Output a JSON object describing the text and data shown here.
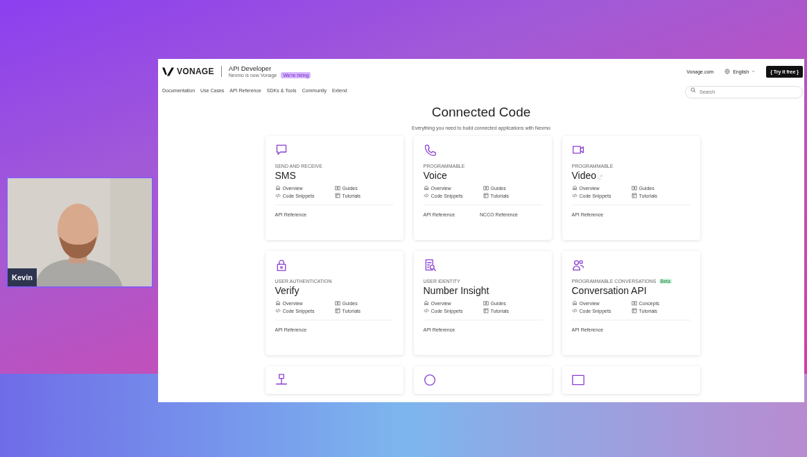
{
  "participant": {
    "kind": "picture",
    "name": "Kevin"
  },
  "browser": {
    "header": {
      "logo": "VONAGE",
      "product": "API Developer",
      "tagline": "Nexmo is now Vonage",
      "badge": "We're hiring",
      "site_link": "Vonage.com",
      "language": "English",
      "cta": "{ Try it free }"
    },
    "nav": [
      "Documentation",
      "Use Cases",
      "API Reference",
      "SDKs & Tools",
      "Community",
      "Extend"
    ],
    "search": {
      "placeholder": "Search"
    },
    "hero": {
      "title": "Connected Code",
      "subtitle": "Everything you need to build connected applications with Nexmo"
    },
    "cards": [
      {
        "kind": "full",
        "eyebrow": "SEND AND RECEIVE",
        "title": "SMS",
        "external": false,
        "links": [
          "Overview",
          "Guides",
          "Code Snippets",
          "Tutorials"
        ],
        "footer": [
          "API Reference"
        ]
      },
      {
        "kind": "full",
        "eyebrow": "PROGRAMMABLE",
        "title": "Voice",
        "external": false,
        "links": [
          "Overview",
          "Guides",
          "Code Snippets",
          "Tutorials"
        ],
        "footer": [
          "API Reference",
          "NCCO Reference"
        ]
      },
      {
        "kind": "full",
        "eyebrow": "PROGRAMMABLE",
        "title": "Video",
        "external": true,
        "links": [
          "Overview",
          "Guides",
          "Code Snippets",
          "Tutorials"
        ],
        "footer": [
          "API Reference"
        ]
      },
      {
        "kind": "full",
        "eyebrow": "USER AUTHENTICATION",
        "title": "Verify",
        "external": false,
        "links": [
          "Overview",
          "Guides",
          "Code Snippets",
          "Tutorials"
        ],
        "footer": [
          "API Reference"
        ]
      },
      {
        "kind": "full",
        "eyebrow": "USER IDENTITY",
        "title": "Number Insight",
        "external": false,
        "links": [
          "Overview",
          "Guides",
          "Code Snippets",
          "Tutorials"
        ],
        "footer": [
          "API Reference"
        ]
      },
      {
        "kind": "full",
        "eyebrow": "PROGRAMMABLE CONVERSATIONS",
        "badge": "Beta",
        "title": "Conversation API",
        "external": false,
        "links": [
          "Overview",
          "Concepts",
          "Code Snippets",
          "Tutorials"
        ],
        "footer": [
          "API Reference"
        ]
      },
      {
        "kind": "partial"
      },
      {
        "kind": "partial"
      },
      {
        "kind": "partial"
      }
    ]
  }
}
